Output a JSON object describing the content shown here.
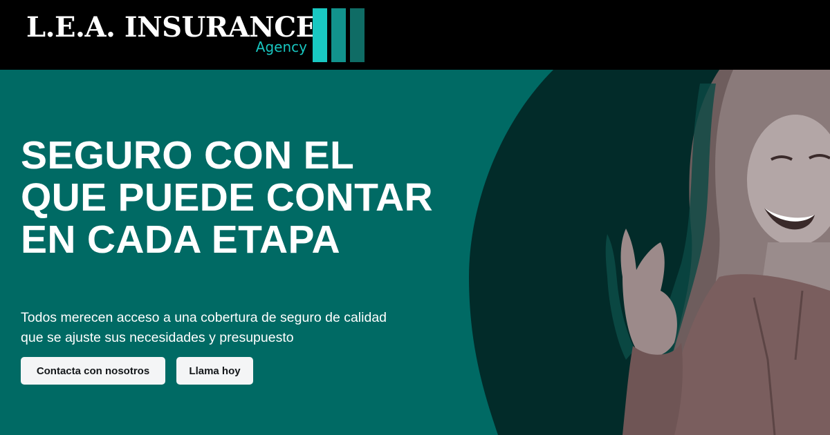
{
  "header": {
    "logo": {
      "wordmark": "L.E.A. INSURANCE",
      "subtitle": "Agency",
      "bar_colors": [
        "#19c8c2",
        "#12938d",
        "#0f6c65"
      ]
    }
  },
  "hero": {
    "title": "SEGURO CON EL QUE PUEDE CONTAR EN CADA ETAPA",
    "subtitle": "Todos merecen acceso a una cobertura de seguro de calidad que se ajuste sus necesidades y presupuesto",
    "buttons": {
      "contact_label": "Contacta con nosotros",
      "call_label": "Llama hoy"
    },
    "image": "smiling-woman-photo",
    "colors": {
      "background": "#006a64",
      "dark_circle": "#022b29",
      "text": "#ffffff",
      "button_bg": "#f4f5f6"
    }
  }
}
